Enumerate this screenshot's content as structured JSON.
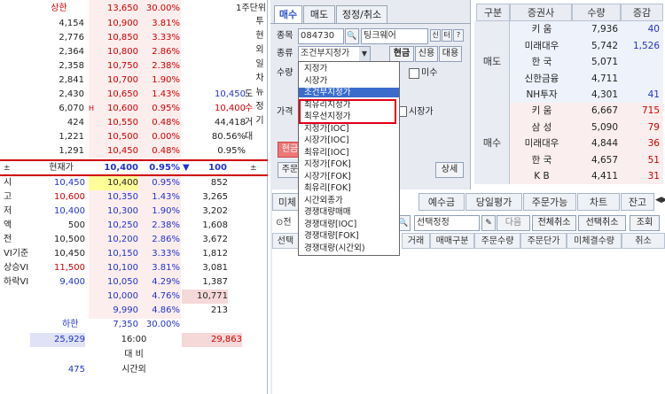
{
  "orderbook": {
    "header": {
      "label": "상한",
      "price": "13,650",
      "pct": "30.00%",
      "aux": "1주단위"
    },
    "asks": [
      {
        "vol": "4,154",
        "price": "10,900",
        "pct": "3.81%",
        "aux": ""
      },
      {
        "vol": "2,776",
        "price": "10,850",
        "pct": "3.33%",
        "aux": ""
      },
      {
        "vol": "2,364",
        "price": "10,800",
        "pct": "2.86%",
        "aux": ""
      },
      {
        "vol": "2,358",
        "price": "10,750",
        "pct": "2.38%",
        "aux": ""
      },
      {
        "vol": "2,841",
        "price": "10,700",
        "pct": "1.90%",
        "aux": ""
      },
      {
        "vol": "2,430",
        "price": "10,650",
        "pct": "1.43%",
        "aux": "10,450"
      },
      {
        "vol": "6,070",
        "price": "10,600",
        "pct": "0.95%",
        "aux": "10,400"
      },
      {
        "vol": "424",
        "price": "10,550",
        "pct": "0.48%",
        "aux": "44,418"
      },
      {
        "vol": "1,221",
        "price": "10,500",
        "pct": "0.00%",
        "aux": "80.56%"
      },
      {
        "vol": "1,291",
        "price": "10,450",
        "pct": "0.48%",
        "aux": "0.95%"
      }
    ],
    "ask_side_labels": [
      "도",
      "수",
      "거",
      "대",
      ""
    ],
    "h_marker": "H",
    "side_tabs": [
      "투",
      "현",
      "외",
      "일",
      "차",
      "뉴",
      "정",
      "기"
    ],
    "current": {
      "label": "현재가",
      "price": "10,400",
      "pct": "0.95%",
      "arrow": "▼",
      "diff": "100"
    },
    "bid_labels": [
      "시",
      "고",
      "저",
      "액",
      "전",
      "VI기준",
      "상승VI",
      "하락VI",
      "",
      "",
      ""
    ],
    "bid_label_values": [
      "10,450",
      "10,600",
      "10,400",
      "500",
      "10,500",
      "10,450",
      "11,500",
      "9,400",
      "",
      "",
      ""
    ],
    "bids": [
      {
        "price": "10,400",
        "pct": "0.95%",
        "vol": "852"
      },
      {
        "price": "10,350",
        "pct": "1.43%",
        "vol": "3,265"
      },
      {
        "price": "10,300",
        "pct": "1.90%",
        "vol": "3,202"
      },
      {
        "price": "10,250",
        "pct": "2.38%",
        "vol": "1,608"
      },
      {
        "price": "10,200",
        "pct": "2.86%",
        "vol": "3,672"
      },
      {
        "price": "10,150",
        "pct": "3.33%",
        "vol": "1,812"
      },
      {
        "price": "10,100",
        "pct": "3.81%",
        "vol": "3,081"
      },
      {
        "price": "10,050",
        "pct": "4.29%",
        "vol": "1,387"
      },
      {
        "price": "10,000",
        "pct": "4.76%",
        "vol": "10,771"
      },
      {
        "price": "9,990",
        "pct": "4.86%",
        "vol": "213"
      }
    ],
    "footer": {
      "label": "하한",
      "price": "7,350",
      "pct": "30.00%",
      "ask_total": "25,929",
      "time": "16:00",
      "bid_total": "29,863",
      "compare_label": "대  비",
      "after_hours_vol": "475",
      "after_hours_label": "시간외"
    }
  },
  "order_panel": {
    "tabs": [
      "매수",
      "매도",
      "정정/취소"
    ],
    "code_label": "종목",
    "code_value": "084730",
    "stock_name": "팅크웨어",
    "small_btns": [
      "신",
      "터",
      "?"
    ],
    "type_label": "종류",
    "type_value": "조건부지정가",
    "cash_btn": "현금",
    "credit_btn": "신용",
    "loan_btn": "대용",
    "qty_label": "수량",
    "price_label": "가격",
    "misu_label": "미수",
    "market_label": "시장가",
    "buy_btn": "현금",
    "main_label": "주문",
    "detail_btn": "상세"
  },
  "dropdown": {
    "items": [
      "지정가",
      "시장가",
      "조건부지정가",
      "최유리지정가",
      "최우선지정가",
      "지정가[IOC]",
      "시장가[IOC]",
      "최유리[IOC]",
      "지정가[FOK]",
      "시장가[FOK]",
      "최유리[FOK]",
      "시간외종가",
      "경쟁대량매매",
      "경쟁대량[IOC]",
      "경쟁대량[FOK]",
      "경쟁대량(시간외)"
    ]
  },
  "brokers": {
    "headers": [
      "구분",
      "증권사",
      "수량",
      "증감"
    ],
    "sell_label": "매도",
    "buy_label": "매수",
    "sell": [
      {
        "name": "키    움",
        "qty": "7,936",
        "chg": "40"
      },
      {
        "name": "미래대우",
        "qty": "5,742",
        "chg": "1,526"
      },
      {
        "name": "한    국",
        "qty": "5,071",
        "chg": ""
      },
      {
        "name": "신한금융",
        "qty": "4,711",
        "chg": ""
      },
      {
        "name": "NH투자",
        "qty": "4,301",
        "chg": "41"
      }
    ],
    "buy": [
      {
        "name": "키    움",
        "qty": "6,667",
        "chg": "715"
      },
      {
        "name": "삼    성",
        "qty": "5,090",
        "chg": "79"
      },
      {
        "name": "미래대우",
        "qty": "4,844",
        "chg": "36"
      },
      {
        "name": "한    국",
        "qty": "4,657",
        "chg": "51"
      },
      {
        "name": "K      B",
        "qty": "4,411",
        "chg": "31"
      }
    ]
  },
  "bottom": {
    "tabs": [
      "미체",
      "예수금",
      "당일평가",
      "주문가능",
      "차트",
      "잔고"
    ],
    "filter_prefix": "전",
    "select_label": "선택정정",
    "next_btn": "다음",
    "cancel_all_btn": "전체취소",
    "cancel_sel_btn": "선택취소",
    "query_btn": "조회",
    "columns": [
      "선택",
      "거래",
      "매매구분",
      "주문수량",
      "주문단가",
      "미체결수량",
      "취소"
    ]
  }
}
